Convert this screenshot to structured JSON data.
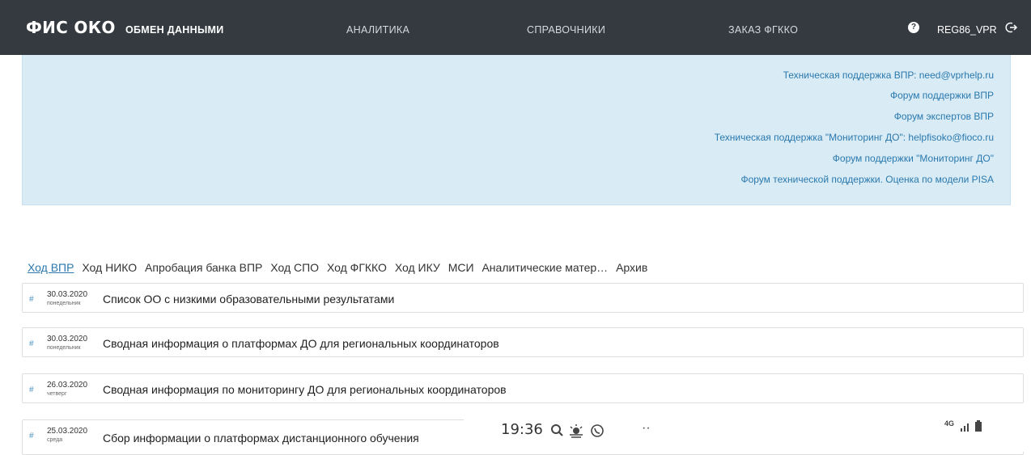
{
  "navbar": {
    "logo": "ФИС ОКО",
    "items": [
      {
        "label": "ОБМЕН ДАННЫМИ",
        "active": true
      },
      {
        "label": "АНАЛИТИКА",
        "active": false
      },
      {
        "label": "СПРАВОЧНИКИ",
        "active": false
      },
      {
        "label": "ЗАКАЗ ФГККО",
        "active": false
      }
    ],
    "help_glyph": "?",
    "user": "REG86_VPR"
  },
  "info_links": [
    "Техническая поддержка ВПР: need@vprhelp.ru",
    "Форум поддержки ВПР",
    "Форум экспертов ВПР",
    "Техническая поддержка \"Мониторинг ДО\": helpfisoko@fioco.ru",
    "Форум поддержки \"Мониторинг ДО\"",
    "Форум технической поддержки. Оценка по модели PISA"
  ],
  "tabs": [
    {
      "label": "Ход ВПР",
      "active": true
    },
    {
      "label": "Ход НИКО",
      "active": false
    },
    {
      "label": "Апробация банка ВПР",
      "active": false
    },
    {
      "label": "Ход СПО",
      "active": false
    },
    {
      "label": "Ход ФГККО",
      "active": false
    },
    {
      "label": "Ход ИКУ",
      "active": false
    },
    {
      "label": "МСИ",
      "active": false
    },
    {
      "label": "Аналитические матер…",
      "active": false
    },
    {
      "label": "Архив",
      "active": false
    }
  ],
  "rows": [
    {
      "hash": "#",
      "date": "30.03.2020",
      "day": "понедельник",
      "title": "Список ОО с низкими образовательными результатами"
    },
    {
      "hash": "#",
      "date": "30.03.2020",
      "day": "понедельник",
      "title": "Сводная информация о платформах ДО для региональных координаторов"
    },
    {
      "hash": "#",
      "date": "26.03.2020",
      "day": "четверг",
      "title": "Сводная информация по мониторингу ДО для региональных координаторов"
    },
    {
      "hash": "#",
      "date": "25.03.2020",
      "day": "среда",
      "title": "Сбор информации о платформах дистанционного обучения"
    }
  ],
  "statusbar": {
    "time": "19:36",
    "dots": "··",
    "network": "4G",
    "icons": [
      "search-icon",
      "weather-icon",
      "viber-icon",
      "signal-icon",
      "battery-icon"
    ]
  },
  "colors": {
    "navbar_bg": "#343a40",
    "info_bg": "#d9ecf6",
    "link": "#2a78ad"
  }
}
